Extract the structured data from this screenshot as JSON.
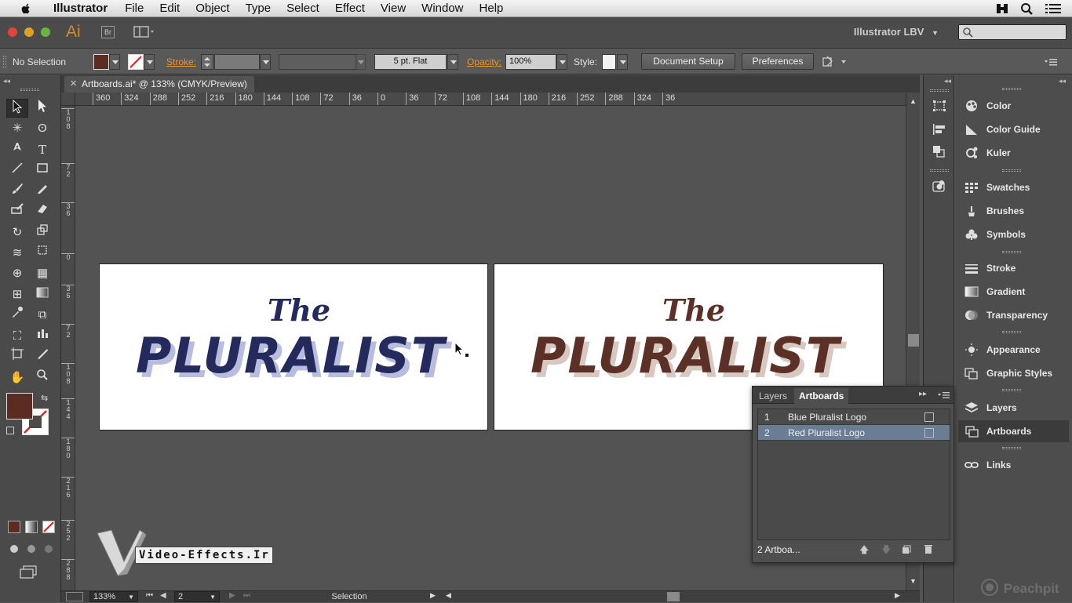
{
  "menubar": {
    "app_name": "Illustrator",
    "items": [
      "File",
      "Edit",
      "Object",
      "Type",
      "Select",
      "Effect",
      "View",
      "Window",
      "Help"
    ]
  },
  "appbar": {
    "logo": "Ai",
    "bridge_label": "Br",
    "workspace": "Illustrator LBV"
  },
  "control": {
    "selection": "No Selection",
    "stroke_label": "Stroke:",
    "brush": "5 pt. Flat",
    "opacity_label": "Opacity:",
    "opacity_value": "100%",
    "style_label": "Style:",
    "document_setup": "Document Setup",
    "preferences": "Preferences"
  },
  "document": {
    "tab_title": "Artboards.ai* @ 133% (CMYK/Preview)"
  },
  "ruler": {
    "h_ticks": [
      "360",
      "324",
      "288",
      "252",
      "216",
      "180",
      "144",
      "108",
      "72",
      "36",
      "0",
      "36",
      "72",
      "108",
      "144",
      "180",
      "216",
      "252",
      "288",
      "324",
      "36"
    ],
    "v_ticks": [
      "1\n0\n8",
      "7\n2",
      "3\n6",
      "0",
      "3\n6",
      "7\n2",
      "1\n0\n8",
      "1\n4\n4",
      "1\n8\n0",
      "2\n1\n6",
      "2\n5\n2",
      "2\n8\n8"
    ]
  },
  "artwork": {
    "line1": "The",
    "line2": "PLURALIST",
    "blue": "#242a5c",
    "blue_shadow": "#b8bde0",
    "red": "#5b3026",
    "red_shadow": "#d8c8c0"
  },
  "colors": {
    "fill_swatch": "#5b2c22",
    "selected_row": "#6b7c95",
    "accent_orange": "#e8952a"
  },
  "right_panel": {
    "items": [
      "Color",
      "Color Guide",
      "Kuler",
      "Swatches",
      "Brushes",
      "Symbols",
      "Stroke",
      "Gradient",
      "Transparency",
      "Appearance",
      "Graphic Styles",
      "Layers",
      "Artboards",
      "Links"
    ]
  },
  "artboards_panel": {
    "tab_layers": "Layers",
    "tab_artboards": "Artboards",
    "rows": [
      {
        "num": "1",
        "name": "Blue Pluralist Logo"
      },
      {
        "num": "2",
        "name": "Red Pluralist Logo"
      }
    ],
    "footer": "2 Artboa..."
  },
  "statusbar": {
    "zoom": "133%",
    "artboard_num": "2",
    "tool": "Selection"
  },
  "watermark": {
    "vfx": "Video-Effects.Ir",
    "peachpit": "Peachpit"
  }
}
